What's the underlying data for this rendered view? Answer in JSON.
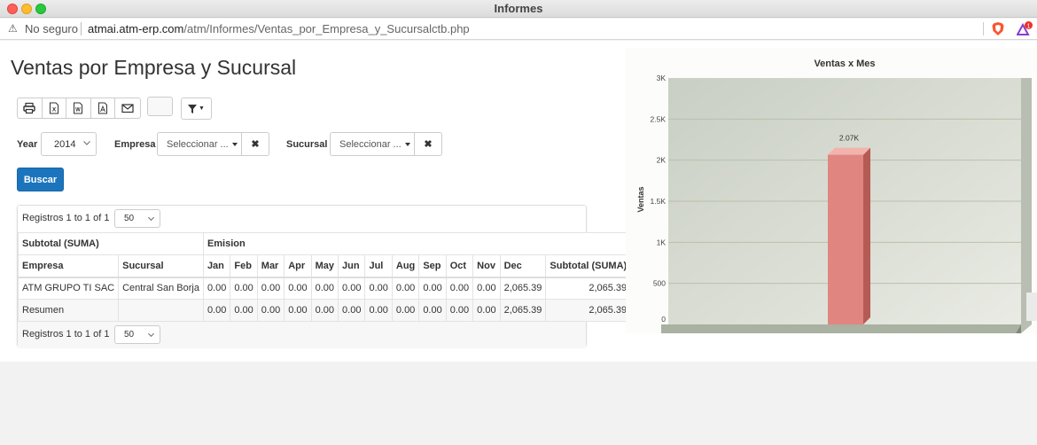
{
  "window": {
    "title": "Informes"
  },
  "address_bar": {
    "security_label": "No seguro",
    "url_host": "atmai.atm-erp.com",
    "url_path": "/atm/Informes/Ventas_por_Empresa_y_Sucursalctb.php",
    "extension_badge": "1"
  },
  "page": {
    "title": "Ventas por Empresa y Sucursal"
  },
  "toolbar": {
    "icons": [
      "print-icon",
      "excel-icon",
      "word-icon",
      "pdf-icon",
      "email-icon"
    ],
    "filter_icon": "filter-icon"
  },
  "filters": {
    "year_label": "Year",
    "year_value": "2014",
    "empresa_label": "Empresa",
    "empresa_placeholder": "Seleccionar ...",
    "sucursal_label": "Sucursal",
    "sucursal_placeholder": "Seleccionar ...",
    "clear_glyph": "✖"
  },
  "search_button": {
    "label": "Buscar"
  },
  "report": {
    "pager_text": "Registros 1 to 1 of 1",
    "page_size": "50",
    "group_headers": [
      "Subtotal (SUMA)",
      "Emision"
    ],
    "columns": [
      "Empresa",
      "Sucursal",
      "Jan",
      "Feb",
      "Mar",
      "Apr",
      "May",
      "Jun",
      "Jul",
      "Aug",
      "Sep",
      "Oct",
      "Nov",
      "Dec",
      "Subtotal (SUMA)"
    ],
    "rows": [
      [
        "ATM GRUPO TI SAC",
        "Central San Borja",
        "0.00",
        "0.00",
        "0.00",
        "0.00",
        "0.00",
        "0.00",
        "0.00",
        "0.00",
        "0.00",
        "0.00",
        "0.00",
        "2,065.39",
        "2,065.39"
      ]
    ],
    "summary_row": [
      "Resumen",
      "",
      "0.00",
      "0.00",
      "0.00",
      "0.00",
      "0.00",
      "0.00",
      "0.00",
      "0.00",
      "0.00",
      "0.00",
      "0.00",
      "2,065.39",
      "2,065.39"
    ]
  },
  "chart_data": {
    "type": "bar",
    "title": "Ventas x Mes",
    "ylabel": "Ventas",
    "xlabel": "",
    "ylim": [
      0,
      3000
    ],
    "yticks": [
      0,
      500,
      1000,
      1500,
      2000,
      2500,
      3000
    ],
    "ytick_labels": [
      "0",
      "500",
      "1K",
      "1.5K",
      "2K",
      "2.5K",
      "3K"
    ],
    "categories": [
      ""
    ],
    "values": [
      2065.39
    ],
    "data_labels": [
      "2.07K"
    ],
    "bar_color": "#e0857f",
    "grid": true,
    "legend": "none"
  }
}
